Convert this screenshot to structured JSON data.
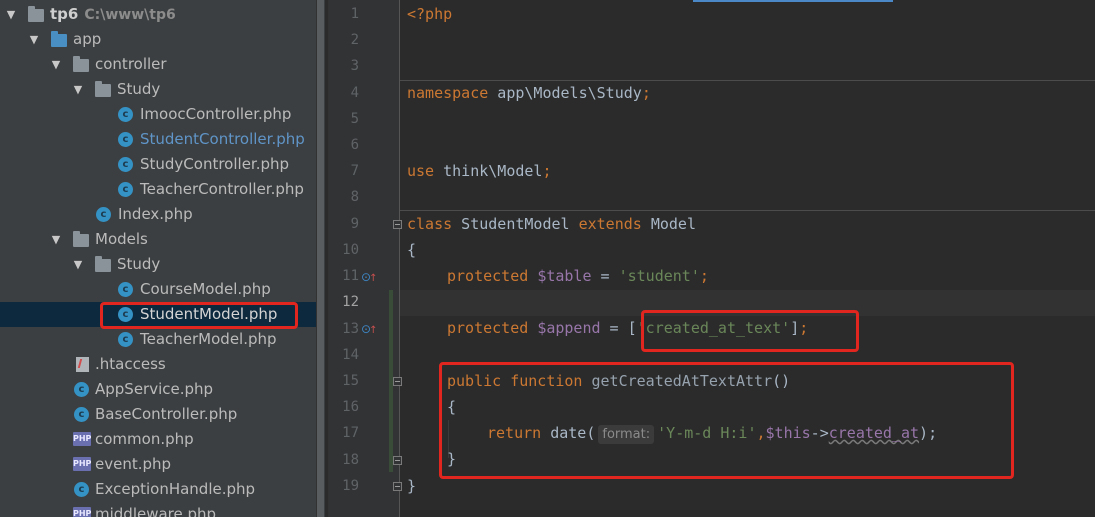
{
  "project_tree": {
    "root": {
      "name": "tp6",
      "path": "C:\\www\\tp6"
    },
    "items": [
      {
        "label": "app"
      },
      {
        "label": "controller"
      },
      {
        "label": "Study"
      },
      {
        "label": "ImoocController.php"
      },
      {
        "label": "StudentController.php"
      },
      {
        "label": "StudyController.php"
      },
      {
        "label": "TeacherController.php"
      },
      {
        "label": "Index.php"
      },
      {
        "label": "Models"
      },
      {
        "label": "Study"
      },
      {
        "label": "CourseModel.php"
      },
      {
        "label": "StudentModel.php"
      },
      {
        "label": "TeacherModel.php"
      },
      {
        "label": ".htaccess"
      },
      {
        "label": "AppService.php"
      },
      {
        "label": "BaseController.php"
      },
      {
        "label": "common.php"
      },
      {
        "label": "event.php"
      },
      {
        "label": "ExceptionHandle.php"
      },
      {
        "label": "middleware.php"
      }
    ],
    "icon_glyphs": {
      "class_icon": "c",
      "php_icon": "PHP",
      "expanded": "▼"
    }
  },
  "editor": {
    "lines": [
      "1",
      "2",
      "3",
      "4",
      "5",
      "6",
      "7",
      "8",
      "9",
      "10",
      "11",
      "12",
      "13",
      "14",
      "15",
      "16",
      "17",
      "18",
      "19"
    ],
    "code": {
      "l1": "<?php",
      "l4_kw": "namespace",
      "l4_rest": " app\\Models\\Study",
      "l4_semi": ";",
      "l7_kw": "use",
      "l7_rest": " think\\Model",
      "l7_semi": ";",
      "l9_kw1": "class",
      "l9_name": " StudentModel ",
      "l9_kw2": "extends",
      "l9_parent": " Model",
      "l10": "{",
      "l11_kw": "protected",
      "l11_var": "$table",
      "l11_eq": " = ",
      "l11_str": "'student'",
      "l11_semi": ";",
      "l13_kw": "protected",
      "l13_var": "$append",
      "l13_eq": " = ",
      "l13_open": "[",
      "l13_str": "'created_at_text'",
      "l13_close": "]",
      "l13_semi": ";",
      "l15_kw1": "public",
      "l15_kw2": "function",
      "l15_name": "getCreatedAtTextAttr",
      "l15_paren": "()",
      "l16": "{",
      "l17_kw": "return",
      "l17_fn": " date(",
      "l17_hint": "format:",
      "l17_str": "'Y-m-d H:i'",
      "l17_comma": ",",
      "l17_this": "$this",
      "l17_arrow": "->",
      "l17_prop": "created_at",
      "l17_end": ");",
      "l18": "}",
      "l19": "}"
    }
  },
  "colors": {
    "highlight": "#e0261f",
    "keyword": "#cc7832",
    "string": "#6a8759",
    "variable": "#9876aa"
  }
}
